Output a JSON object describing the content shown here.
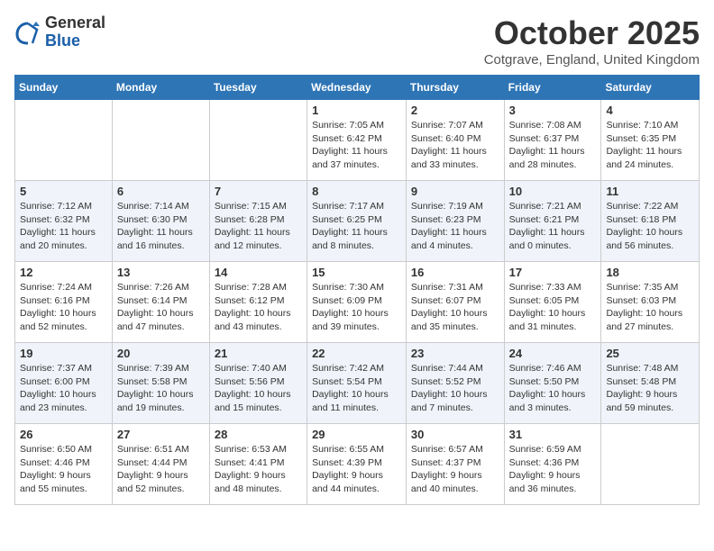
{
  "logo": {
    "general": "General",
    "blue": "Blue"
  },
  "title": "October 2025",
  "location": "Cotgrave, England, United Kingdom",
  "days_of_week": [
    "Sunday",
    "Monday",
    "Tuesday",
    "Wednesday",
    "Thursday",
    "Friday",
    "Saturday"
  ],
  "weeks": [
    [
      {
        "day": "",
        "info": ""
      },
      {
        "day": "",
        "info": ""
      },
      {
        "day": "",
        "info": ""
      },
      {
        "day": "1",
        "info": "Sunrise: 7:05 AM\nSunset: 6:42 PM\nDaylight: 11 hours and 37 minutes."
      },
      {
        "day": "2",
        "info": "Sunrise: 7:07 AM\nSunset: 6:40 PM\nDaylight: 11 hours and 33 minutes."
      },
      {
        "day": "3",
        "info": "Sunrise: 7:08 AM\nSunset: 6:37 PM\nDaylight: 11 hours and 28 minutes."
      },
      {
        "day": "4",
        "info": "Sunrise: 7:10 AM\nSunset: 6:35 PM\nDaylight: 11 hours and 24 minutes."
      }
    ],
    [
      {
        "day": "5",
        "info": "Sunrise: 7:12 AM\nSunset: 6:32 PM\nDaylight: 11 hours and 20 minutes."
      },
      {
        "day": "6",
        "info": "Sunrise: 7:14 AM\nSunset: 6:30 PM\nDaylight: 11 hours and 16 minutes."
      },
      {
        "day": "7",
        "info": "Sunrise: 7:15 AM\nSunset: 6:28 PM\nDaylight: 11 hours and 12 minutes."
      },
      {
        "day": "8",
        "info": "Sunrise: 7:17 AM\nSunset: 6:25 PM\nDaylight: 11 hours and 8 minutes."
      },
      {
        "day": "9",
        "info": "Sunrise: 7:19 AM\nSunset: 6:23 PM\nDaylight: 11 hours and 4 minutes."
      },
      {
        "day": "10",
        "info": "Sunrise: 7:21 AM\nSunset: 6:21 PM\nDaylight: 11 hours and 0 minutes."
      },
      {
        "day": "11",
        "info": "Sunrise: 7:22 AM\nSunset: 6:18 PM\nDaylight: 10 hours and 56 minutes."
      }
    ],
    [
      {
        "day": "12",
        "info": "Sunrise: 7:24 AM\nSunset: 6:16 PM\nDaylight: 10 hours and 52 minutes."
      },
      {
        "day": "13",
        "info": "Sunrise: 7:26 AM\nSunset: 6:14 PM\nDaylight: 10 hours and 47 minutes."
      },
      {
        "day": "14",
        "info": "Sunrise: 7:28 AM\nSunset: 6:12 PM\nDaylight: 10 hours and 43 minutes."
      },
      {
        "day": "15",
        "info": "Sunrise: 7:30 AM\nSunset: 6:09 PM\nDaylight: 10 hours and 39 minutes."
      },
      {
        "day": "16",
        "info": "Sunrise: 7:31 AM\nSunset: 6:07 PM\nDaylight: 10 hours and 35 minutes."
      },
      {
        "day": "17",
        "info": "Sunrise: 7:33 AM\nSunset: 6:05 PM\nDaylight: 10 hours and 31 minutes."
      },
      {
        "day": "18",
        "info": "Sunrise: 7:35 AM\nSunset: 6:03 PM\nDaylight: 10 hours and 27 minutes."
      }
    ],
    [
      {
        "day": "19",
        "info": "Sunrise: 7:37 AM\nSunset: 6:00 PM\nDaylight: 10 hours and 23 minutes."
      },
      {
        "day": "20",
        "info": "Sunrise: 7:39 AM\nSunset: 5:58 PM\nDaylight: 10 hours and 19 minutes."
      },
      {
        "day": "21",
        "info": "Sunrise: 7:40 AM\nSunset: 5:56 PM\nDaylight: 10 hours and 15 minutes."
      },
      {
        "day": "22",
        "info": "Sunrise: 7:42 AM\nSunset: 5:54 PM\nDaylight: 10 hours and 11 minutes."
      },
      {
        "day": "23",
        "info": "Sunrise: 7:44 AM\nSunset: 5:52 PM\nDaylight: 10 hours and 7 minutes."
      },
      {
        "day": "24",
        "info": "Sunrise: 7:46 AM\nSunset: 5:50 PM\nDaylight: 10 hours and 3 minutes."
      },
      {
        "day": "25",
        "info": "Sunrise: 7:48 AM\nSunset: 5:48 PM\nDaylight: 9 hours and 59 minutes."
      }
    ],
    [
      {
        "day": "26",
        "info": "Sunrise: 6:50 AM\nSunset: 4:46 PM\nDaylight: 9 hours and 55 minutes."
      },
      {
        "day": "27",
        "info": "Sunrise: 6:51 AM\nSunset: 4:44 PM\nDaylight: 9 hours and 52 minutes."
      },
      {
        "day": "28",
        "info": "Sunrise: 6:53 AM\nSunset: 4:41 PM\nDaylight: 9 hours and 48 minutes."
      },
      {
        "day": "29",
        "info": "Sunrise: 6:55 AM\nSunset: 4:39 PM\nDaylight: 9 hours and 44 minutes."
      },
      {
        "day": "30",
        "info": "Sunrise: 6:57 AM\nSunset: 4:37 PM\nDaylight: 9 hours and 40 minutes."
      },
      {
        "day": "31",
        "info": "Sunrise: 6:59 AM\nSunset: 4:36 PM\nDaylight: 9 hours and 36 minutes."
      },
      {
        "day": "",
        "info": ""
      }
    ]
  ]
}
